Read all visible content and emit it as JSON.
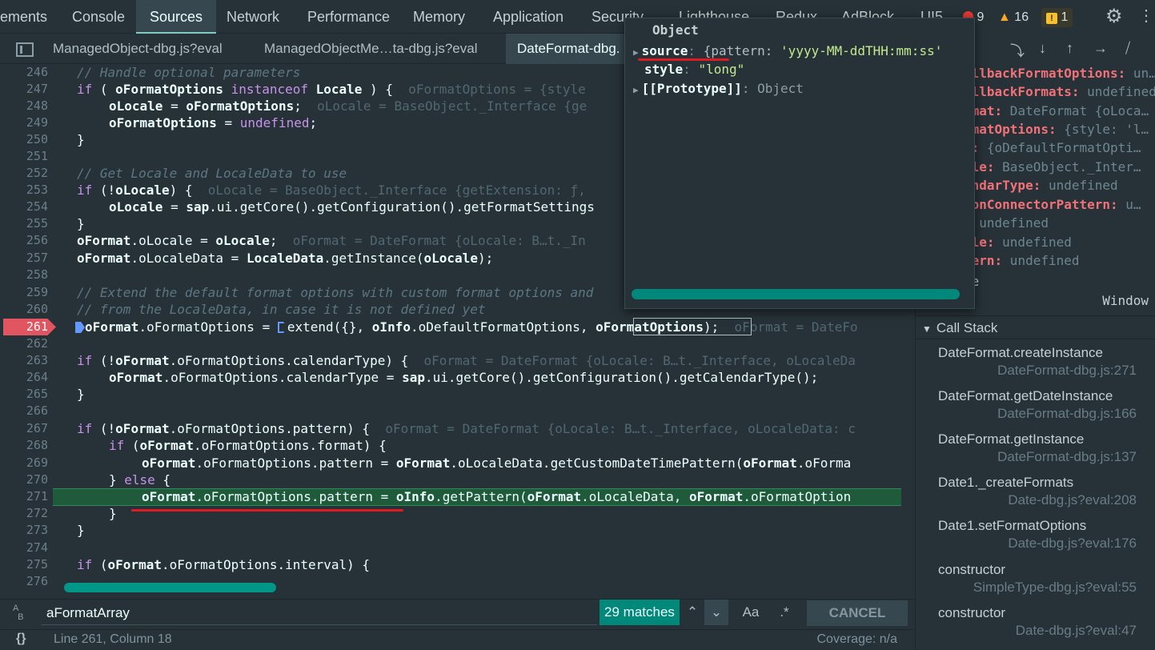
{
  "top_tabs": [
    "ements",
    "Console",
    "Sources",
    "Network",
    "Performance",
    "Memory",
    "Application",
    "Security",
    "Lighthouse",
    "Redux",
    "AdBlock",
    "UI5"
  ],
  "badges": {
    "errors": "9",
    "warnings": "16",
    "issues": "1"
  },
  "file_tabs": [
    "ManagedObject-dbg.js?eval",
    "ManagedObjectMe…ta-dbg.js?eval",
    "DateFormat-dbg."
  ],
  "popover": {
    "title": "Object",
    "source_key": "source",
    "source_sep": ":",
    "source_open": "{pattern:",
    "source_val": "'yyyy-MM-ddTHH:mm:ss'",
    "style_key": "style",
    "style_sep": ":",
    "style_val": "\"long\"",
    "proto_key": "[[Prototype]]",
    "proto_val": ": Object"
  },
  "scope": [
    {
      "k": "allbackFormatOptions:",
      "v": " un…"
    },
    {
      "k": "allbackFormats:",
      "v": " undefined"
    },
    {
      "k": "rmat:",
      "v": " DateFormat {oLoca…"
    },
    {
      "k": "rmatOptions:",
      "v": " {style: 'l…"
    },
    {
      "k": "o:",
      "v": " {oDefaultFormatOpti…"
    },
    {
      "k": "ale:",
      "v": " BaseObject._Inter…"
    },
    {
      "k": "endarType:",
      "v": " undefined"
    },
    {
      "k": "monConnectorPattern:",
      "v": " u…"
    },
    {
      "k": "",
      "v": ": undefined"
    },
    {
      "k": "ale:",
      "v": " undefined"
    },
    {
      "k": "tern:",
      "v": " undefined"
    },
    {
      "k": "",
      "v": "re"
    }
  ],
  "window_label": "Window",
  "call_stack_title": "Call Stack",
  "call_stack": [
    {
      "fn": "DateFormat.createInstance",
      "loc": "DateFormat-dbg.js:271"
    },
    {
      "fn": "DateFormat.getDateInstance",
      "loc": "DateFormat-dbg.js:166"
    },
    {
      "fn": "DateFormat.getInstance",
      "loc": "DateFormat-dbg.js:137"
    },
    {
      "fn": "Date1._createFormats",
      "loc": "Date-dbg.js?eval:208"
    },
    {
      "fn": "Date1.setFormatOptions",
      "loc": "Date-dbg.js?eval:176"
    },
    {
      "fn": "constructor",
      "loc": "SimpleType-dbg.js?eval:55"
    },
    {
      "fn": "constructor",
      "loc": "Date-dbg.js?eval:47"
    }
  ],
  "search": {
    "value": "aFormatArray",
    "matches": "29 matches",
    "match_case": "Aa",
    "regex": ".*",
    "cancel": "CANCEL"
  },
  "status": {
    "position": "Line 261, Column 18",
    "coverage": "Coverage: n/a"
  },
  "line_numbers": [
    "246",
    "247",
    "248",
    "249",
    "250",
    "251",
    "252",
    "253",
    "254",
    "255",
    "256",
    "257",
    "258",
    "259",
    "260",
    "261",
    "262",
    "263",
    "264",
    "265",
    "266",
    "267",
    "268",
    "269",
    "270",
    "271",
    "272",
    "273",
    "274",
    "275",
    "276"
  ],
  "code": {
    "l246": "// Handle optional parameters",
    "l247_kw": "if",
    "l247_a": " ( ",
    "l247_b": "oFormatOptions",
    "l247_c": " instanceof ",
    "l247_d": "Locale",
    "l247_e": " ) {",
    "l247_i": "oFormatOptions = {style",
    "l248_a": "oLocale",
    "l248_b": " = ",
    "l248_c": "oFormatOptions",
    "l248_d": ";",
    "l248_i": "oLocale = BaseObject._Interface {ge",
    "l249_a": "oFormatOptions",
    "l249_b": " = ",
    "l249_c": "undefined",
    "l249_d": ";",
    "l250": "}",
    "l252": "// Get Locale and LocaleData to use",
    "l253_kw": "if",
    "l253_a": " (!",
    "l253_b": "oLocale",
    "l253_c": ") {",
    "l253_i": "oLocale = BaseObject._Interface {getExtension: ƒ,",
    "l254_a": "oLocale",
    "l254_b": " = ",
    "l254_c": "sap",
    "l254_d": ".ui.",
    "l254_e": "getCore",
    "l254_f": "().",
    "l254_g": "getConfiguration",
    "l254_h": "().",
    "l254_j": "getFormatSettings",
    "l255": "}",
    "l256_a": "oFormat",
    "l256_b": ".oLocale = ",
    "l256_c": "oLocale",
    "l256_d": ";",
    "l256_i": "oFormat = DateFormat {oLocale: B…t._In",
    "l257_a": "oFormat",
    "l257_b": ".oLocaleData = ",
    "l257_c": "LocaleData",
    "l257_d": ".",
    "l257_e": "getInstance",
    "l257_f": "(",
    "l257_g": "oLocale",
    "l257_h": ");",
    "l259": "// Extend the default format options with custom format options and",
    "l260": "// from the LocaleData, in case it is not defined yet",
    "l261_a": "oFormat",
    "l261_b": ".oFormatOptions = ",
    "l261_c": "extend",
    "l261_d": "({}, ",
    "l261_e": "oInfo",
    "l261_f": ".oDefaultFormatOptions, ",
    "l261_g": "oFormatOptions",
    "l261_h": ");",
    "l261_i": "oFormat = DateFo",
    "l263_kw": "if",
    "l263_a": " (!",
    "l263_b": "oFormat",
    "l263_c": ".oFormatOptions.calendarType) {",
    "l263_i": "oFormat = DateFormat {oLocale: B…t._Interface, oLocaleDa",
    "l264_a": "oFormat",
    "l264_b": ".oFormatOptions.calendarType = ",
    "l264_c": "sap",
    "l264_d": ".ui.",
    "l264_e": "getCore",
    "l264_f": "().",
    "l264_g": "getConfiguration",
    "l264_h": "().",
    "l264_j": "getCalendarType",
    "l264_k": "();",
    "l265": "}",
    "l267_kw": "if",
    "l267_a": " (!",
    "l267_b": "oFormat",
    "l267_c": ".oFormatOptions.pattern) {",
    "l267_i": "oFormat = DateFormat {oLocale: B…t._Interface, oLocaleData: c",
    "l268_kw": "if",
    "l268_a": " (",
    "l268_b": "oFormat",
    "l268_c": ".oFormatOptions.format) {",
    "l269_a": "oFormat",
    "l269_b": ".oFormatOptions.pattern = ",
    "l269_c": "oFormat",
    "l269_d": ".oLocaleData.",
    "l269_e": "getCustomDateTimePattern",
    "l269_f": "(",
    "l269_g": "oFormat",
    "l269_h": ".oForma",
    "l270_a": "} ",
    "l270_kw": "else",
    "l270_b": " {",
    "l271_a": "oFormat",
    "l271_b": ".oFormatOptions.pattern = ",
    "l271_c": "oInfo",
    "l271_d": ".",
    "l271_e": "getPattern",
    "l271_f": "(",
    "l271_g": "oFormat",
    "l271_h": ".oLocaleData, ",
    "l271_j": "oFormat",
    "l271_k": ".oFormatOption",
    "l272": "}",
    "l273": "}",
    "l275_kw": "if",
    "l275_a": " (",
    "l275_b": "oFormat",
    "l275_c": ".oFormatOptions.interval) {"
  },
  "colors": {
    "accent": "#80cbc4",
    "breakpoint": "#e0555f",
    "exec_line": "#1f5b3b",
    "annotation_red": "#e01b22",
    "scrollbar": "#009688"
  }
}
